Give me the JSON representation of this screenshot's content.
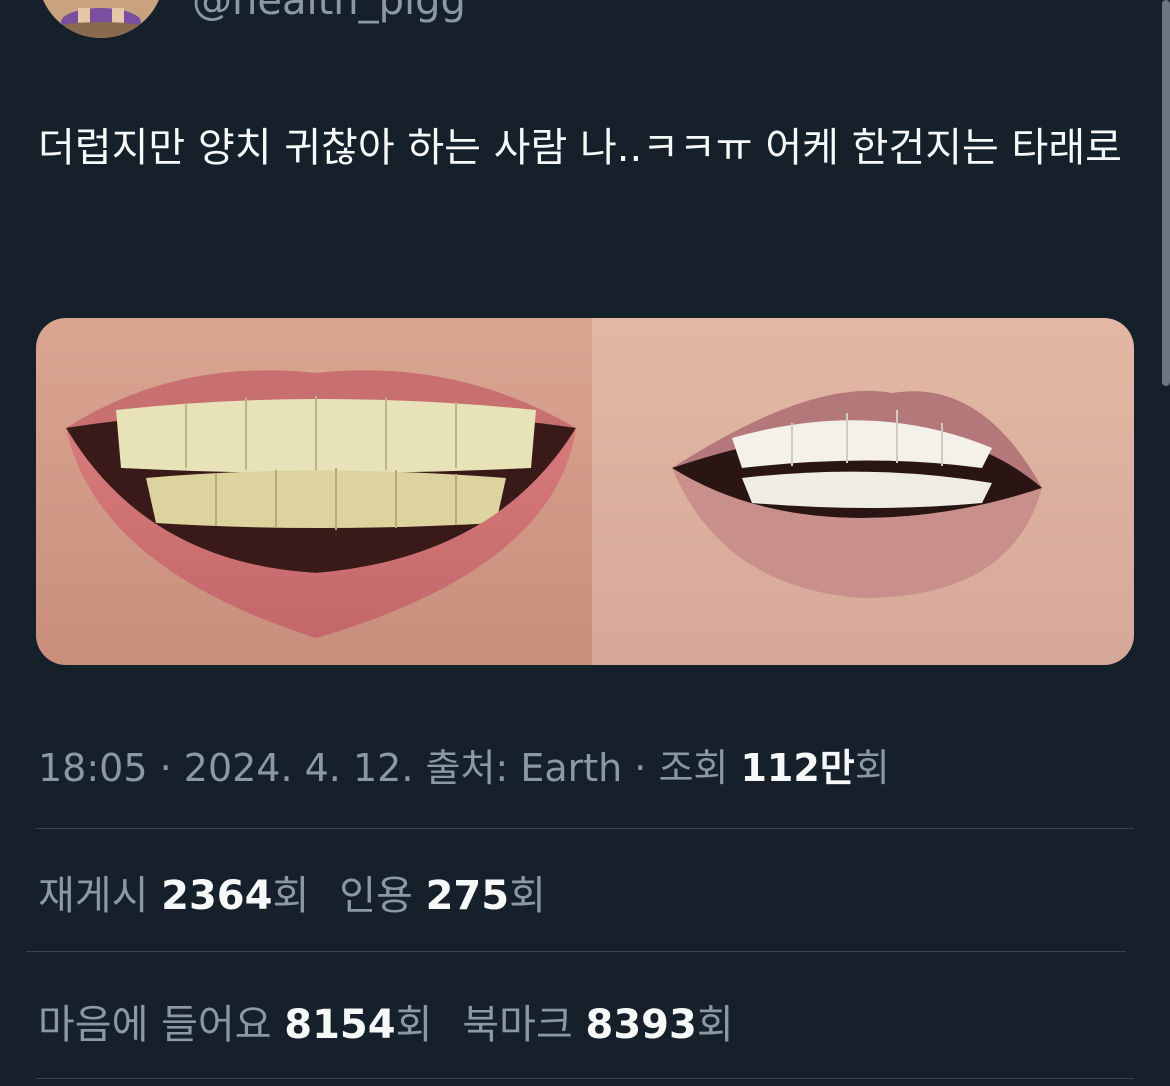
{
  "author": {
    "handle": "@health_pigg"
  },
  "tweet": {
    "text": "더럽지만 양치 귀찮아 하는 사람 나..ㅋㅋㅠ 어케 한건지는 타래로"
  },
  "meta": {
    "time": "18:05",
    "separator": " · ",
    "date": "2024. 4. 12.",
    "source_label": "출처: ",
    "source": "Earth",
    "views_label": "조회 ",
    "views_value": "112만",
    "views_suffix": "회"
  },
  "stats": {
    "retweets_label": "재게시 ",
    "retweets_value": "2364",
    "retweets_suffix": "회",
    "quotes_label": "인용 ",
    "quotes_value": "275",
    "quotes_suffix": "회",
    "likes_label": "마음에 들어요 ",
    "likes_value": "8154",
    "likes_suffix": "회",
    "bookmarks_label": "북마크 ",
    "bookmarks_value": "8393",
    "bookmarks_suffix": "회"
  },
  "colors": {
    "background": "#15202b",
    "text_primary": "#f7f9f9",
    "text_secondary": "#8b98a5",
    "divider": "#38444d"
  }
}
